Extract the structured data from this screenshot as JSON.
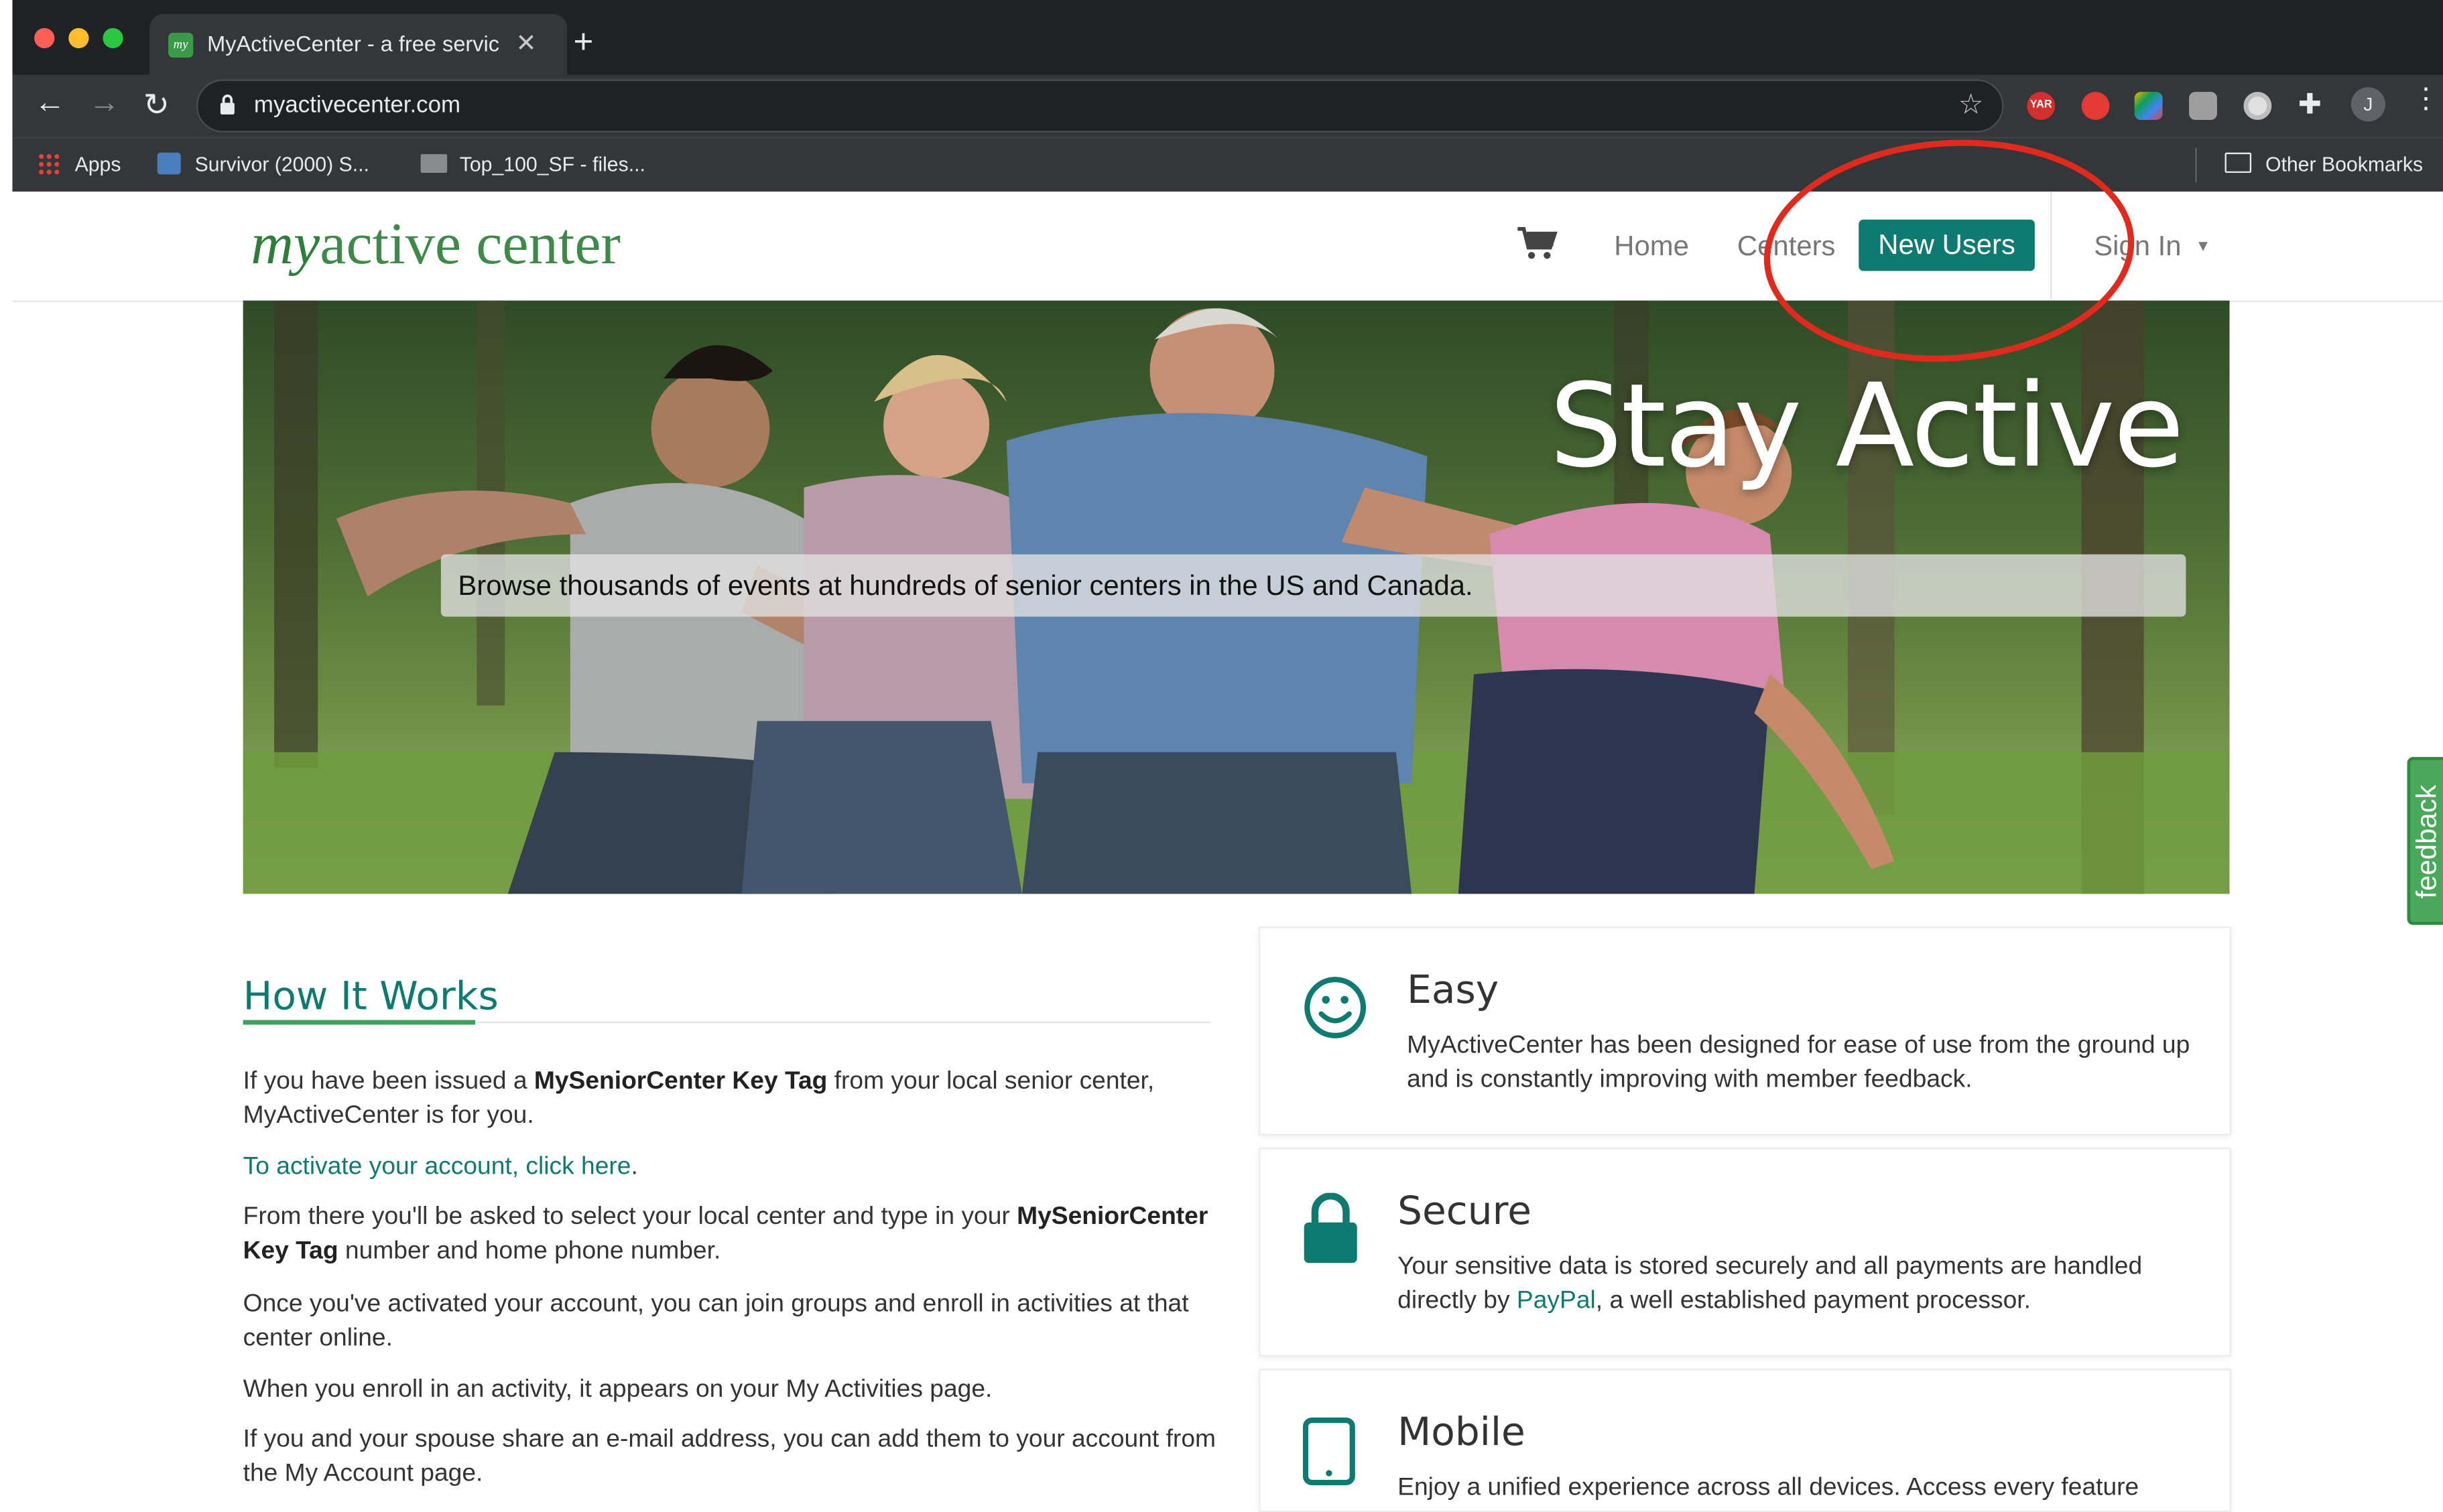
{
  "browser": {
    "tab_title": "MyActiveCenter - a free servic",
    "tab_favicon_text": "my",
    "url": "myactivecenter.com",
    "ext_badge": "YAR",
    "profile_initial": "J",
    "bookmarks": [
      {
        "label": "Apps"
      },
      {
        "label": "Survivor (2000) S..."
      },
      {
        "label": "Top_100_SF - files..."
      }
    ],
    "other_bookmarks": "Other Bookmarks"
  },
  "site": {
    "logo_my": "my",
    "logo_rest": "active center",
    "nav": {
      "home": "Home",
      "centers": "Centers",
      "new_users": "New Users",
      "sign_in": "Sign In"
    }
  },
  "hero": {
    "title": "Stay Active",
    "subtitle": "Browse thousands of events at hundreds of senior centers in the US and Canada."
  },
  "how_it_works": {
    "title": "How It Works",
    "p1_prefix": "If you have been issued a ",
    "p1_bold": "MySeniorCenter Key Tag",
    "p1_suffix": " from your local senior center, MyActiveCenter is for you.",
    "activate_link": "To activate your account, click here",
    "activate_period": ".",
    "p2_prefix": "From there you'll be asked to select your local center and type in your ",
    "p2_bold": "MySeniorCenter Key Tag",
    "p2_suffix": " number and home phone number.",
    "p3": "Once you've activated your account, you can join groups and enroll in activities at that center online.",
    "p4": "When you enroll in an activity, it appears on your My Activities page.",
    "p5": "If you and your spouse share an e-mail address, you can add them to your account from the My Account page."
  },
  "features": {
    "easy": {
      "title": "Easy",
      "text": "MyActiveCenter has been designed for ease of use from the ground up and is constantly improving with member feedback."
    },
    "secure": {
      "title": "Secure",
      "text_prefix": "Your sensitive data is stored securely and all payments are handled directly by ",
      "link": "PayPal",
      "text_suffix": ", a well established payment processor."
    },
    "mobile": {
      "title": "Mobile",
      "text": "Enjoy a unified experience across all devices. Access every feature"
    }
  },
  "feedback_label": "feedback",
  "colors": {
    "brand_teal": "#0f7a70",
    "brand_green": "#3f8a4a",
    "annotation_red": "#e02a1e"
  }
}
